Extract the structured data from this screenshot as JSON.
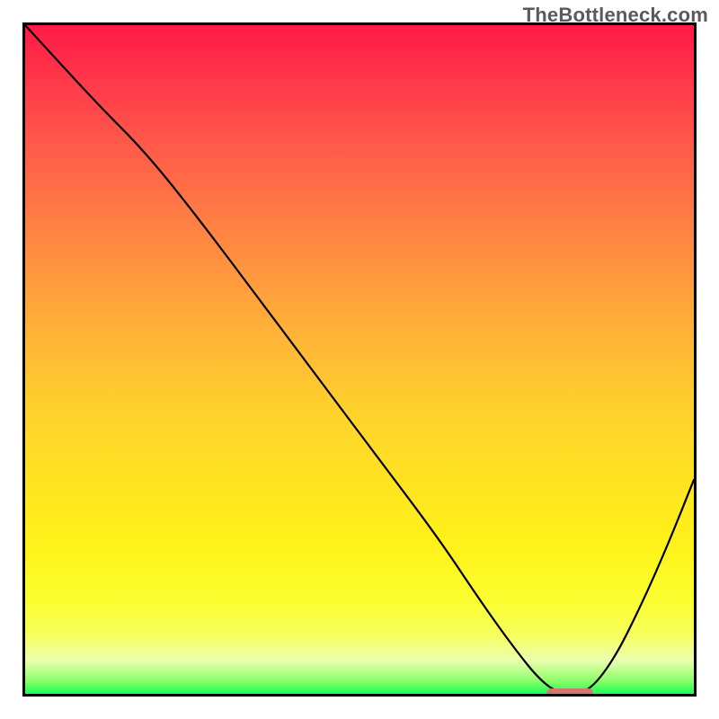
{
  "watermark": "TheBottleneck.com",
  "chart_data": {
    "type": "line",
    "title": "",
    "xlabel": "",
    "ylabel": "",
    "xlim": [
      0,
      100
    ],
    "ylim": [
      0,
      100
    ],
    "x": [
      0,
      11,
      18,
      26,
      35,
      44,
      53,
      62,
      68,
      73,
      77,
      80,
      84,
      88,
      92,
      96,
      100
    ],
    "values": [
      100,
      88,
      81,
      71,
      59,
      47,
      35,
      23,
      14,
      7,
      2,
      0,
      0,
      5,
      13,
      22,
      32
    ],
    "gradient_stops": [
      {
        "pos": 0,
        "color": "#ff1a46"
      },
      {
        "pos": 18,
        "color": "#ff5a4a"
      },
      {
        "pos": 38,
        "color": "#ff9a3e"
      },
      {
        "pos": 58,
        "color": "#ffd22c"
      },
      {
        "pos": 78,
        "color": "#fff21a"
      },
      {
        "pos": 95,
        "color": "#ecffb0"
      },
      {
        "pos": 100,
        "color": "#1aff55"
      }
    ],
    "optimal_range_x": [
      78,
      85
    ],
    "optimal_marker_color": "#d9736e"
  }
}
